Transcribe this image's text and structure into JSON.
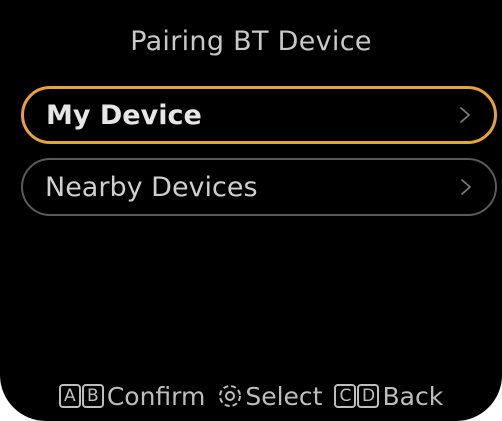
{
  "screen": {
    "title": "Pairing BT Device"
  },
  "menu": {
    "items": [
      {
        "label": "My Device",
        "selected": true,
        "chevron": ">"
      },
      {
        "label": "Nearby Devices",
        "selected": false,
        "chevron": ">"
      }
    ]
  },
  "footer": {
    "confirm": {
      "keys": [
        "A",
        "B"
      ],
      "label": "Confirm"
    },
    "select": {
      "icon": "dial-icon",
      "label": "Select"
    },
    "back": {
      "keys": [
        "C",
        "D"
      ],
      "label": "Back"
    }
  },
  "colors": {
    "background": "#000000",
    "accent": "#e8a23c",
    "text": "#cfcfcf",
    "border": "#5a5a5a"
  }
}
